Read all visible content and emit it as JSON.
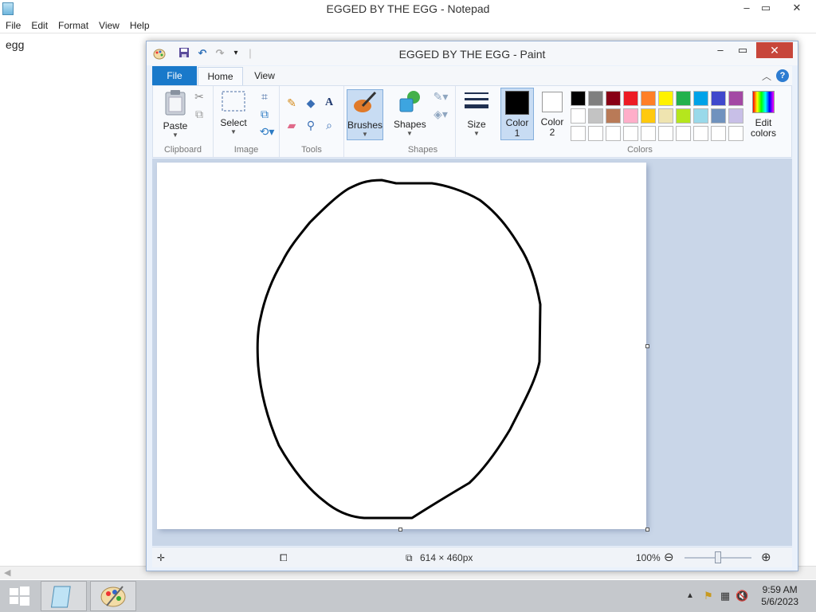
{
  "notepad": {
    "title": "EGGED BY THE EGG - Notepad",
    "menu": [
      "File",
      "Edit",
      "Format",
      "View",
      "Help"
    ],
    "content": "egg",
    "minimize": "–",
    "maximize": "▭",
    "close": "✕"
  },
  "paint": {
    "title": "EGGED BY THE EGG - Paint",
    "tabs": {
      "file": "File",
      "home": "Home",
      "view": "View"
    },
    "groups": {
      "clipboard": "Clipboard",
      "image": "Image",
      "tools": "Tools",
      "shapes": "Shapes",
      "colors": "Colors"
    },
    "buttons": {
      "paste": "Paste",
      "select": "Select",
      "brushes": "Brushes",
      "shapes": "Shapes",
      "size": "Size",
      "color1": "Color\n1",
      "color2": "Color\n2",
      "edit_colors": "Edit\ncolors"
    },
    "color1_label_a": "Color",
    "color1_label_b": "1",
    "color2_label_a": "Color",
    "color2_label_b": "2",
    "edit_colors_a": "Edit",
    "edit_colors_b": "colors",
    "palette_row1": [
      "#000000",
      "#7f7f7f",
      "#880015",
      "#ed1c24",
      "#ff7f27",
      "#fff200",
      "#22b14c",
      "#00a2e8",
      "#3f48cc",
      "#a349a4"
    ],
    "palette_row2": [
      "#ffffff",
      "#c3c3c3",
      "#b97a57",
      "#ffaec9",
      "#ffc90e",
      "#efe4b0",
      "#b5e61d",
      "#99d9ea",
      "#7092be",
      "#c8bfe7"
    ],
    "palette_row3_count": 10,
    "color1_value": "#000000",
    "color2_value": "#ffffff",
    "status": {
      "canvas_size": "614 × 460px",
      "zoom": "100%"
    }
  },
  "taskbar": {
    "time": "9:59 AM",
    "date": "5/6/2023"
  }
}
